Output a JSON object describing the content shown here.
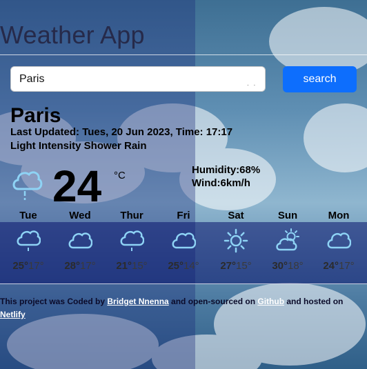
{
  "app": {
    "title": "Weather App"
  },
  "search": {
    "value": "Paris",
    "button_label": "search",
    "dots": ". ."
  },
  "current": {
    "city": "Paris",
    "updated_label": "Last Updated:",
    "updated_value": "Tues, 20 Jun 2023, Time: 17:17",
    "description": "Light Intensity Shower Rain",
    "icon": "rain-cloud-icon",
    "temperature": "24",
    "unit": "°C",
    "humidity": "Humidity:68%",
    "wind": "Wind:6km/h"
  },
  "forecast": [
    {
      "day": "Tue",
      "icon": "rain-cloud-icon",
      "max": "25°",
      "min": "17°"
    },
    {
      "day": "Wed",
      "icon": "cloud-icon",
      "max": "28°",
      "min": "17°"
    },
    {
      "day": "Thur",
      "icon": "rain-cloud-icon",
      "max": "21°",
      "min": "15°"
    },
    {
      "day": "Fri",
      "icon": "cloud-icon",
      "max": "25°",
      "min": "14°"
    },
    {
      "day": "Sat",
      "icon": "sun-icon",
      "max": "27°",
      "min": "15°"
    },
    {
      "day": "Sun",
      "icon": "partly-sunny-icon",
      "max": "30°",
      "min": "18°"
    },
    {
      "day": "Mon",
      "icon": "cloud-icon",
      "max": "24°",
      "min": "17°"
    }
  ],
  "footer": {
    "text1": "This project was Coded by ",
    "author": "Bridget Nnenna",
    "text2": " and open-sourced on ",
    "github": "Github",
    "text3": " and hosted on ",
    "netlify": "Netlify"
  },
  "colors": {
    "accent": "#0d6efd",
    "icon_blue": "#8ed3f5"
  }
}
